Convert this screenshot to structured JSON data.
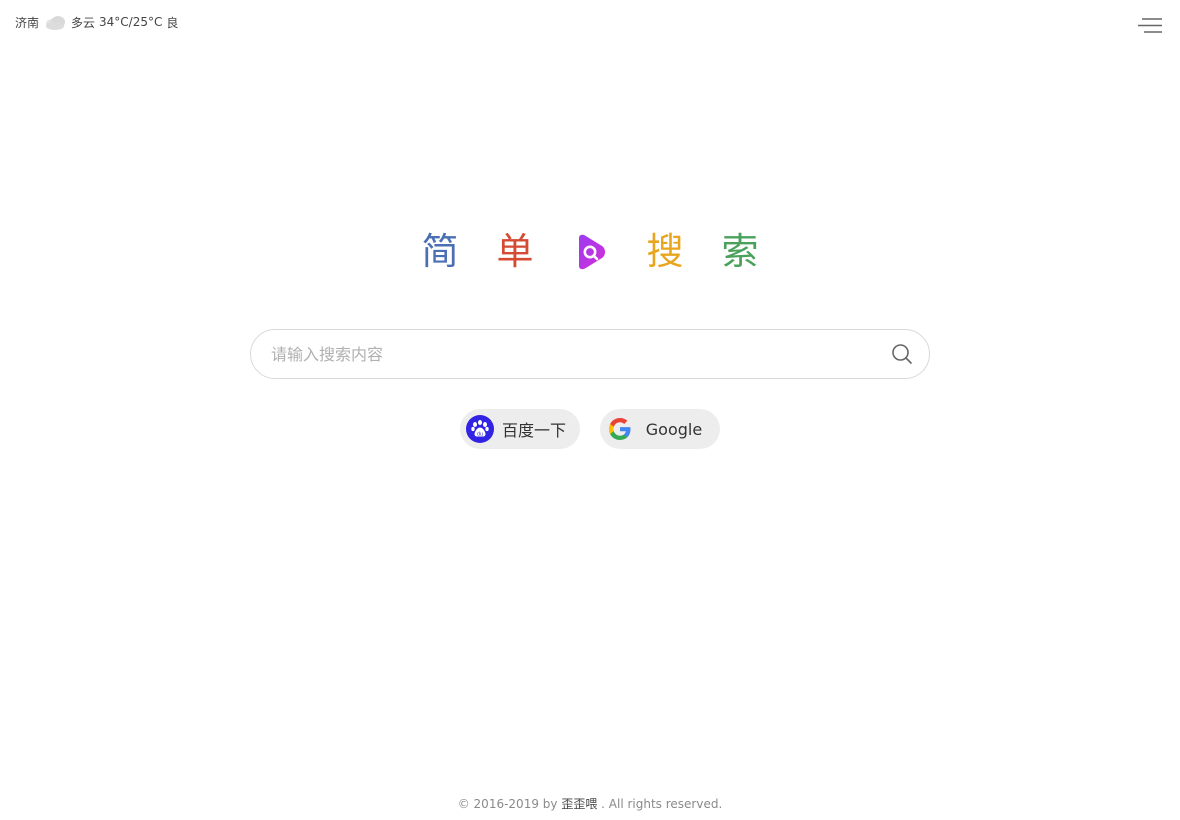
{
  "weather": {
    "city": "济南",
    "icon": "cloud-icon",
    "condition": "多云",
    "temperature": "34°C/25°C",
    "air_quality": "良"
  },
  "menu": {
    "icon": "menu-icon"
  },
  "logo": {
    "chars": [
      "简",
      "单",
      "搜",
      "索"
    ],
    "colors": [
      "#4a6fb5",
      "#d44a32",
      "#e8a620",
      "#4aa15b"
    ],
    "icon": "play-logo-icon",
    "icon_color": "#b233e8"
  },
  "search": {
    "placeholder": "请输入搜索内容",
    "value": "",
    "icon": "search-icon"
  },
  "engines": [
    {
      "label": "百度一下",
      "icon": "baidu-paw-icon",
      "color": "#3222e3"
    },
    {
      "label": "Google",
      "icon": "google-icon"
    }
  ],
  "footer": {
    "prefix": "© 2016-2019 by ",
    "author": "歪歪喂",
    "suffix": " . All rights reserved."
  }
}
